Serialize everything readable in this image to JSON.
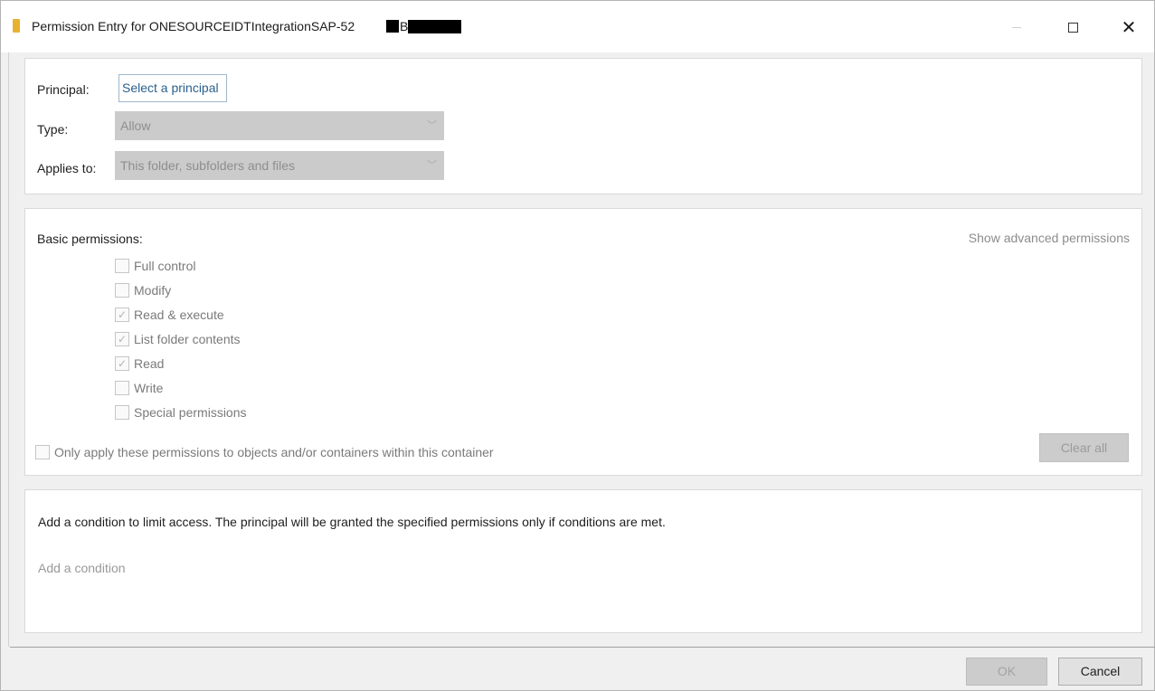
{
  "window": {
    "title": "Permission Entry for ONESOURCEIDTIntegrationSAP-52",
    "title_fragment": "B"
  },
  "principal": {
    "label": "Principal:",
    "link_text": "Select a principal"
  },
  "type": {
    "label": "Type:",
    "value": "Allow"
  },
  "applies_to": {
    "label": "Applies to:",
    "value": "This folder, subfolders and files"
  },
  "permissions": {
    "label": "Basic permissions:",
    "advanced_link": "Show advanced permissions",
    "items": [
      {
        "label": "Full control",
        "checked": false
      },
      {
        "label": "Modify",
        "checked": false
      },
      {
        "label": "Read & execute",
        "checked": true
      },
      {
        "label": "List folder contents",
        "checked": true
      },
      {
        "label": "Read",
        "checked": true
      },
      {
        "label": "Write",
        "checked": false
      },
      {
        "label": "Special permissions",
        "checked": false
      }
    ],
    "only_apply_label": "Only apply these permissions to objects and/or containers within this container",
    "clear_all_label": "Clear all"
  },
  "condition": {
    "description": "Add a condition to limit access. The principal will be granted the specified permissions only if conditions are met.",
    "add_link": "Add a condition"
  },
  "footer": {
    "ok_label": "OK",
    "cancel_label": "Cancel"
  },
  "icons": {
    "title": "folder-icon",
    "check": "checkmark-icon"
  },
  "colors": {
    "link": "#2b5f8c",
    "disabled_fill": "#cbcbcb",
    "folder": "#e8b22f"
  }
}
